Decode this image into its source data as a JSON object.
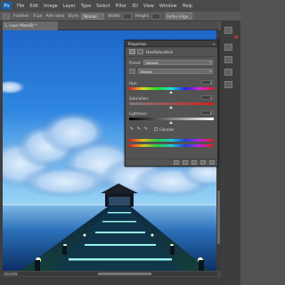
{
  "app": {
    "logo": "Ps",
    "menu": [
      "File",
      "Edit",
      "Image",
      "Layer",
      "Type",
      "Select",
      "Filter",
      "3D",
      "View",
      "Window",
      "Help"
    ]
  },
  "options_bar": {
    "feather_label": "Feather:",
    "feather_value": "0 px",
    "antialias_label": "Anti-alias",
    "style_label": "Style:",
    "style_value": "Normal",
    "width_label": "Width:",
    "height_label": "Height:",
    "refine_button": "Refine Edge..."
  },
  "document": {
    "tab_label": "1, Layer Mask/8) *",
    "zoom": "33.33%",
    "status": "Doc: 2.25M/2.25M"
  },
  "properties": {
    "title": "Properties",
    "section": "Hue/Saturation",
    "preset_label": "Preset:",
    "preset_value": "Default",
    "channel_value": "Master",
    "hue_label": "Hue:",
    "hue_value": "0",
    "saturation_label": "Saturation:",
    "saturation_value": "0",
    "lightness_label": "Lightness:",
    "lightness_value": "0",
    "colorize_label": "Colorize"
  },
  "colors": {
    "panel_bg": "#535353",
    "accent_blue": "#1b5f9e"
  }
}
